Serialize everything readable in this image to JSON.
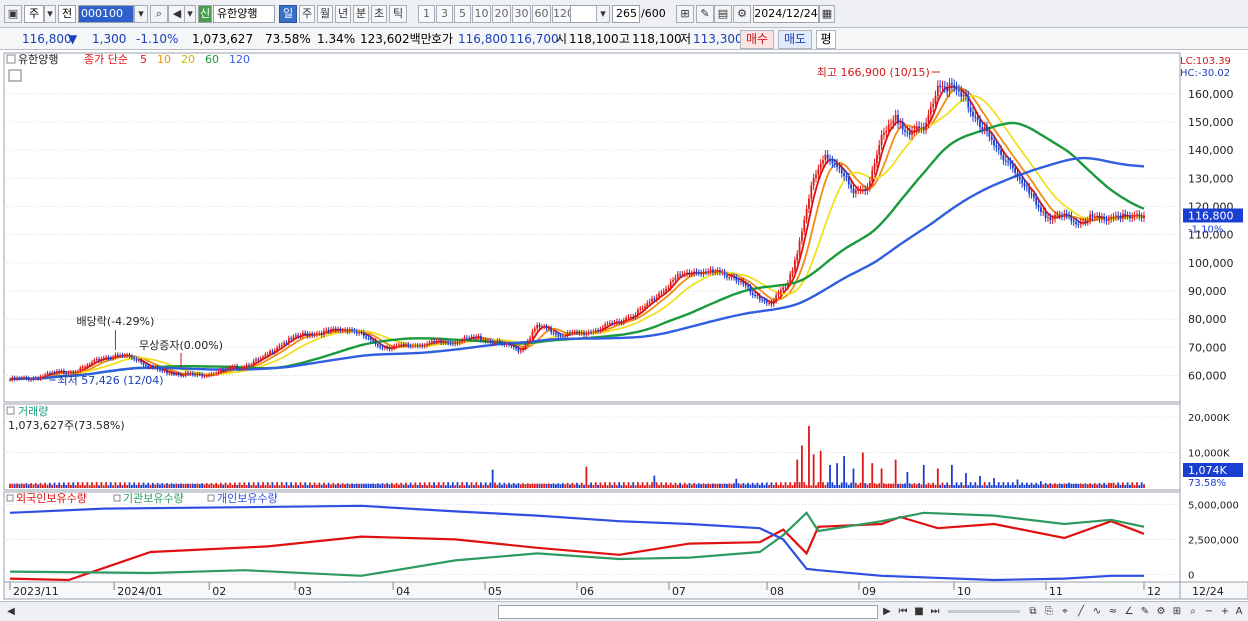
{
  "toolbar": {
    "market": "주",
    "prev": "전",
    "code": "000100",
    "new_badge": "신",
    "stock_name": "유한양행",
    "periods": [
      "일",
      "주",
      "월",
      "년",
      "분",
      "초",
      "틱"
    ],
    "intervals": [
      "1",
      "3",
      "5",
      "10",
      "20",
      "30",
      "60",
      "120"
    ],
    "count": "265",
    "count_total": "/600",
    "date": "2024/12/24"
  },
  "info": {
    "price": "116,800",
    "arrow": "▼",
    "change": "1,300",
    "change_pct": "-1.10%",
    "volume": "1,073,627",
    "volume_ratio": "73.58%",
    "turnover": "1.34%",
    "amount": "123,602백만",
    "quote_label": "호가",
    "ask": "116,800",
    "bid": "116,700",
    "open_label": "시",
    "open": "118,100",
    "high_label": "고",
    "high": "118,100",
    "low_label": "저",
    "low": "113,300",
    "buy_label": "매수",
    "sell_label": "매도",
    "avg_label": "평"
  },
  "price_panel": {
    "title": "유한양행",
    "ma_label": "종가 단순",
    "ma_periods": [
      "5",
      "10",
      "20",
      "60",
      "120"
    ],
    "lc": "LC:103.39",
    "hc": "HC:-30.02",
    "current_tag": "116,800",
    "current_pct_tag": "-1.10%",
    "max_label": "최고 166,900 (10/15)",
    "min_label": "최저 57,426 (12/04)",
    "dividend_label": "배당락(-4.29%)",
    "bonus_label": "무상증자(0.00%)"
  },
  "volume_panel": {
    "title": "거래량",
    "value_label": "1,073,627주(73.58%)",
    "current_tag": "1,074K",
    "current_pct_tag": "73.58%"
  },
  "holdings_panel": {
    "series_labels": [
      "외국인보유수량",
      "기관보유수량",
      "개인보유수량"
    ]
  },
  "colors": {
    "ma5": "#e01010",
    "ma10": "#f08c10",
    "ma20": "#f0e020",
    "ma60": "#1a9a3a",
    "ma120": "#2f5fe0",
    "up": "#e01818",
    "down": "#1a3fd0",
    "foreign": "#e01010",
    "inst": "#2f9a60",
    "individual": "#2f4fe0"
  },
  "chart_data": [
    {
      "type": "candlestick",
      "x_labels": [
        "2023/11",
        "2024/01",
        "02",
        "03",
        "04",
        "05",
        "06",
        "07",
        "08",
        "09",
        "10",
        "11",
        "12",
        "12/24"
      ],
      "yticks": [
        60000,
        70000,
        80000,
        90000,
        100000,
        110000,
        120000,
        130000,
        140000,
        150000,
        160000
      ],
      "ylim": [
        52000,
        172000
      ],
      "close_trend": [
        [
          0,
          58500
        ],
        [
          10,
          59000
        ],
        [
          20,
          61000
        ],
        [
          30,
          62000
        ],
        [
          40,
          66500
        ],
        [
          50,
          67000
        ],
        [
          55,
          65500
        ],
        [
          60,
          63000
        ],
        [
          65,
          61500
        ],
        [
          70,
          61000
        ],
        [
          80,
          60000
        ],
        [
          90,
          61500
        ],
        [
          100,
          63500
        ],
        [
          108,
          66000
        ],
        [
          115,
          71000
        ],
        [
          125,
          74500
        ],
        [
          135,
          75500
        ],
        [
          145,
          76500
        ],
        [
          150,
          74500
        ],
        [
          155,
          71500
        ],
        [
          160,
          70000
        ],
        [
          170,
          70500
        ],
        [
          180,
          71500
        ],
        [
          190,
          72000
        ],
        [
          200,
          73500
        ],
        [
          210,
          71000
        ],
        [
          218,
          69000
        ],
        [
          225,
          77500
        ],
        [
          235,
          74500
        ],
        [
          245,
          75000
        ],
        [
          255,
          77500
        ],
        [
          262,
          80000
        ],
        [
          270,
          83500
        ],
        [
          278,
          90000
        ],
        [
          285,
          95000
        ],
        [
          292,
          97000
        ],
        [
          300,
          96500
        ],
        [
          308,
          95500
        ],
        [
          312,
          93000
        ],
        [
          318,
          87500
        ],
        [
          325,
          86000
        ],
        [
          332,
          92000
        ],
        [
          336,
          104000
        ],
        [
          342,
          127000
        ],
        [
          348,
          138000
        ],
        [
          354,
          134500
        ],
        [
          360,
          124000
        ],
        [
          366,
          127500
        ],
        [
          372,
          144000
        ],
        [
          378,
          151000
        ],
        [
          384,
          147000
        ],
        [
          390,
          146500
        ],
        [
          396,
          163500
        ],
        [
          402,
          162000
        ],
        [
          408,
          157500
        ],
        [
          414,
          149500
        ],
        [
          420,
          141000
        ],
        [
          426,
          136500
        ],
        [
          432,
          128000
        ],
        [
          438,
          121000
        ],
        [
          444,
          115500
        ],
        [
          450,
          116500
        ],
        [
          455,
          114500
        ],
        [
          460,
          116000
        ],
        [
          466,
          115000
        ],
        [
          472,
          117000
        ],
        [
          478,
          115500
        ],
        [
          484,
          116800
        ]
      ],
      "series_names": [
        "5",
        "10",
        "20",
        "60",
        "120"
      ]
    },
    {
      "type": "bar",
      "yticks": [
        10000,
        20000
      ],
      "ytick_labels": [
        "10,000K",
        "20,000K"
      ],
      "ylim": [
        0,
        22000
      ],
      "base_volume": 1100,
      "spikes": [
        [
          206,
          5200
        ],
        [
          246,
          6000
        ],
        [
          275,
          3500
        ],
        [
          310,
          2600
        ],
        [
          336,
          8000
        ],
        [
          338,
          12000
        ],
        [
          341,
          17500
        ],
        [
          343,
          9500
        ],
        [
          346,
          10500
        ],
        [
          350,
          6500
        ],
        [
          353,
          7000
        ],
        [
          356,
          9000
        ],
        [
          360,
          5500
        ],
        [
          364,
          10000
        ],
        [
          368,
          7000
        ],
        [
          372,
          5500
        ],
        [
          378,
          8000
        ],
        [
          383,
          4500
        ],
        [
          390,
          6500
        ],
        [
          396,
          5500
        ],
        [
          402,
          6500
        ],
        [
          408,
          4200
        ],
        [
          414,
          3400
        ],
        [
          420,
          2800
        ],
        [
          430,
          2400
        ],
        [
          440,
          1900
        ],
        [
          452,
          1500
        ],
        [
          470,
          1400
        ],
        [
          484,
          1074
        ]
      ]
    },
    {
      "type": "line",
      "yticks": [
        0,
        2500000,
        5000000
      ],
      "ytick_labels": [
        "0",
        "2,500,000",
        "5,000,000"
      ],
      "ylim": [
        -400000,
        5600000
      ],
      "series": [
        {
          "name": "외국인보유수량",
          "points": [
            [
              0,
              -300000
            ],
            [
              25,
              -400000
            ],
            [
              60,
              1600000
            ],
            [
              110,
              2000000
            ],
            [
              150,
              2700000
            ],
            [
              190,
              2500000
            ],
            [
              225,
              1900000
            ],
            [
              260,
              1400000
            ],
            [
              290,
              2200000
            ],
            [
              320,
              2300000
            ],
            [
              330,
              3200000
            ],
            [
              340,
              1500000
            ],
            [
              345,
              3400000
            ],
            [
              372,
              3600000
            ],
            [
              380,
              4100000
            ],
            [
              396,
              3300000
            ],
            [
              420,
              3600000
            ],
            [
              450,
              2600000
            ],
            [
              470,
              3800000
            ],
            [
              484,
              2900000
            ]
          ]
        },
        {
          "name": "기관보유수량",
          "points": [
            [
              0,
              200000
            ],
            [
              60,
              100000
            ],
            [
              100,
              300000
            ],
            [
              150,
              -100000
            ],
            [
              190,
              1000000
            ],
            [
              225,
              1500000
            ],
            [
              260,
              1100000
            ],
            [
              290,
              1200000
            ],
            [
              320,
              1600000
            ],
            [
              330,
              2800000
            ],
            [
              340,
              4400000
            ],
            [
              345,
              3100000
            ],
            [
              372,
              3800000
            ],
            [
              390,
              4400000
            ],
            [
              420,
              4200000
            ],
            [
              450,
              3600000
            ],
            [
              470,
              3900000
            ],
            [
              484,
              3400000
            ]
          ]
        },
        {
          "name": "개인보유수량",
          "points": [
            [
              0,
              4400000
            ],
            [
              40,
              4700000
            ],
            [
              100,
              4800000
            ],
            [
              150,
              4900000
            ],
            [
              190,
              4500000
            ],
            [
              225,
              4200000
            ],
            [
              260,
              3800000
            ],
            [
              290,
              3600000
            ],
            [
              320,
              3300000
            ],
            [
              330,
              2500000
            ],
            [
              340,
              400000
            ],
            [
              345,
              300000
            ],
            [
              372,
              -100000
            ],
            [
              420,
              -400000
            ],
            [
              450,
              -300000
            ],
            [
              470,
              -100000
            ],
            [
              484,
              -100000
            ]
          ]
        }
      ]
    }
  ]
}
